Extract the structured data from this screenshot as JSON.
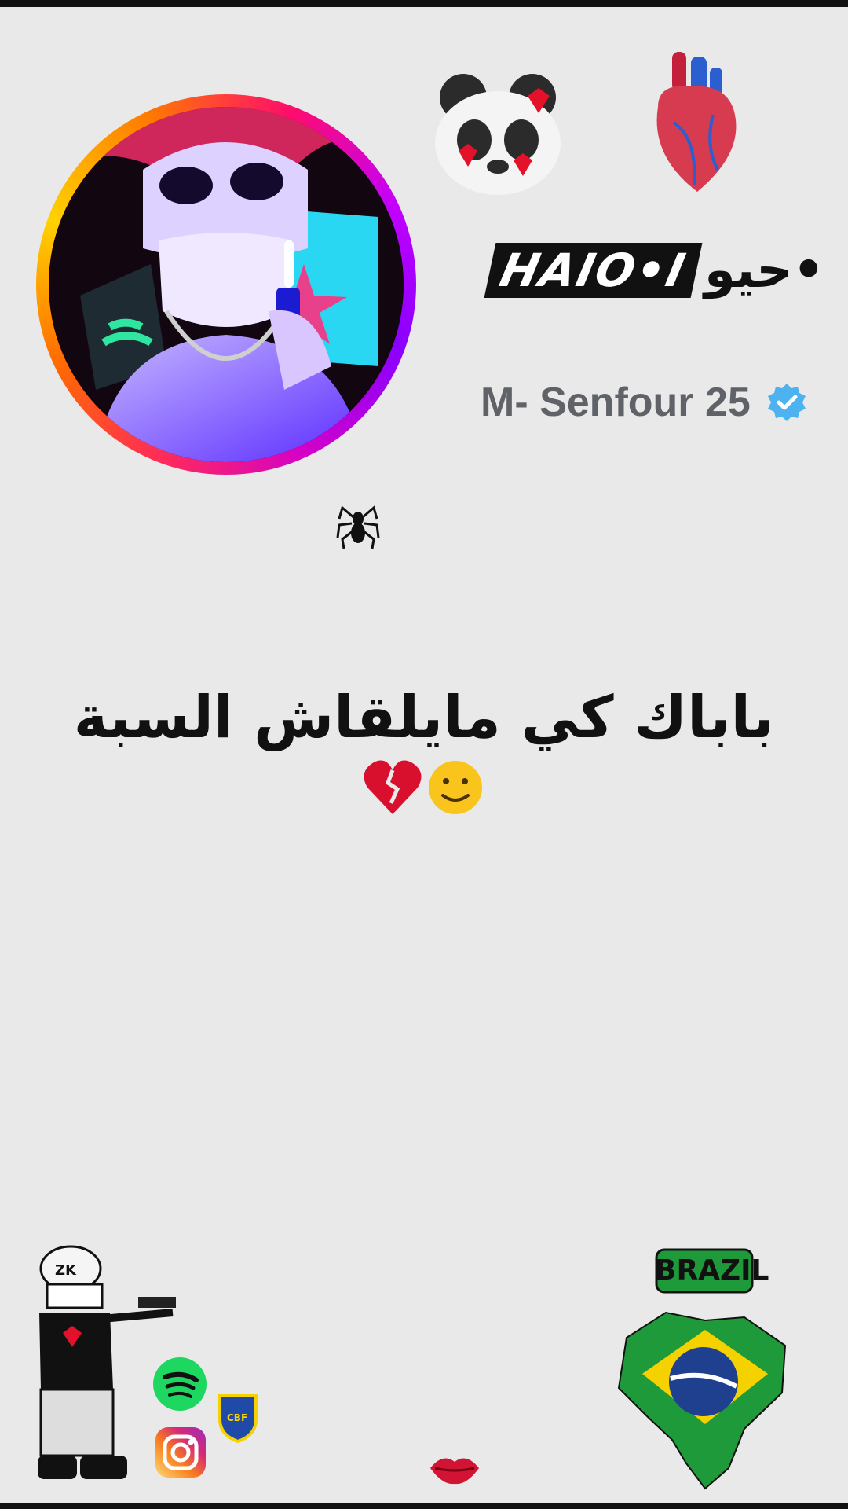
{
  "profile": {
    "brand_latin": "HAIO•I",
    "brand_arabic": "حيو•",
    "username": "M- Senfour 25"
  },
  "stickers": {
    "top_left": "panda-hearts-sticker",
    "top_right": "anatomical-heart-sticker",
    "spider": "spider-icon",
    "bottom_left": "gunman-cartoon-sticker",
    "spotify": "spotify-icon",
    "instagram": "instagram-icon",
    "cbf": "cbf-badge",
    "lips": "lips-icon",
    "brazil_label": "BRAZIL",
    "brazil_map": "brazil-map-sticker"
  },
  "post": {
    "caption": "باباك كي مايلقاش السبة",
    "emoji": "💔🙂"
  },
  "colors": {
    "background": "#e9e9ea",
    "username": "#5f6368",
    "verified": "#4cb3f0",
    "spotify": "#1ed760"
  }
}
